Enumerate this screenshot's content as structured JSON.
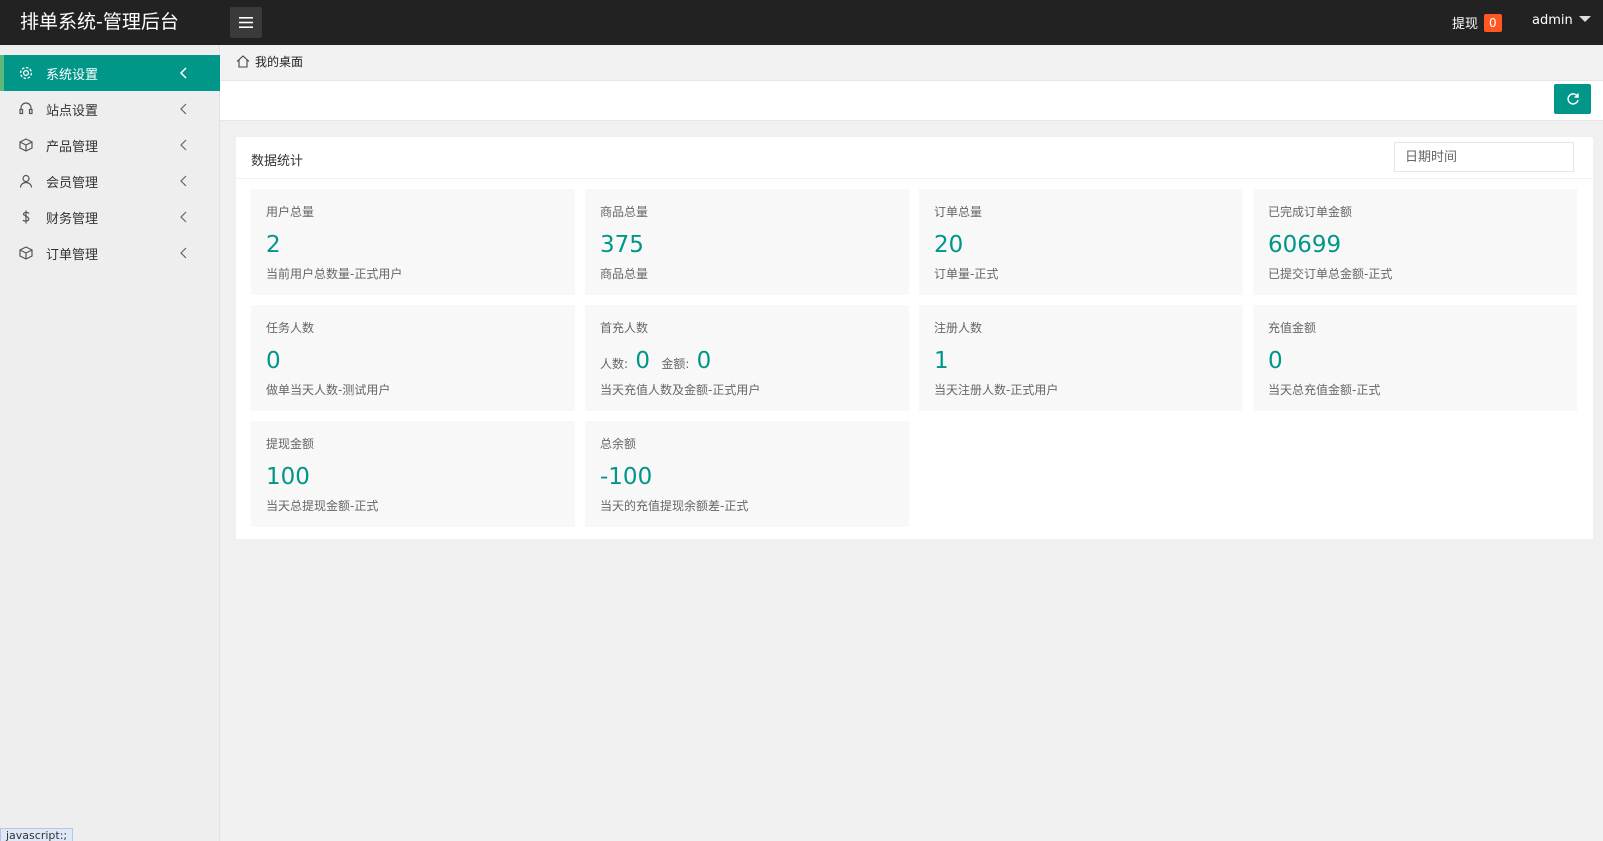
{
  "header": {
    "app_title": "排单系统-管理后台",
    "withdraw_label": "提现",
    "withdraw_badge": "0",
    "user_name": "admin"
  },
  "sidebar": {
    "items": [
      {
        "label": "系统设置",
        "icon": "gear-icon",
        "active": true
      },
      {
        "label": "站点设置",
        "icon": "headset-icon",
        "active": false
      },
      {
        "label": "产品管理",
        "icon": "cube-icon",
        "active": false
      },
      {
        "label": "会员管理",
        "icon": "user-icon",
        "active": false
      },
      {
        "label": "财务管理",
        "icon": "dollar-icon",
        "active": false
      },
      {
        "label": "订单管理",
        "icon": "cube-icon",
        "active": false
      }
    ],
    "status_tip": "javascript:;"
  },
  "tabs": {
    "home_label": "我的桌面"
  },
  "card": {
    "title": "数据统计",
    "date_placeholder": "日期时间"
  },
  "stats": [
    {
      "title": "用户总量",
      "value": "2",
      "desc": "当前用户总数量-正式用户"
    },
    {
      "title": "商品总量",
      "value": "375",
      "desc": "商品总量"
    },
    {
      "title": "订单总量",
      "value": "20",
      "desc": "订单量-正式"
    },
    {
      "title": "已完成订单金额",
      "value": "60699",
      "desc": "已提交订单总金额-正式"
    },
    {
      "title": "任务人数",
      "value": "0",
      "desc": "做单当天人数-测试用户"
    },
    {
      "title": "首充人数",
      "people_label": "人数:",
      "people_value": "0",
      "amount_label": "金额:",
      "amount_value": "0",
      "desc": "当天充值人数及金额-正式用户"
    },
    {
      "title": "注册人数",
      "value": "1",
      "desc": "当天注册人数-正式用户"
    },
    {
      "title": "充值金额",
      "value": "0",
      "desc": "当天总充值金额-正式"
    },
    {
      "title": "提现金额",
      "value": "100",
      "desc": "当天总提现金额-正式"
    },
    {
      "title": "总余额",
      "value": "-100",
      "desc": "当天的充值提现余额差-正式"
    }
  ],
  "colors": {
    "accent": "#009688",
    "header_bg": "#222222",
    "badge": "#ff5722"
  }
}
